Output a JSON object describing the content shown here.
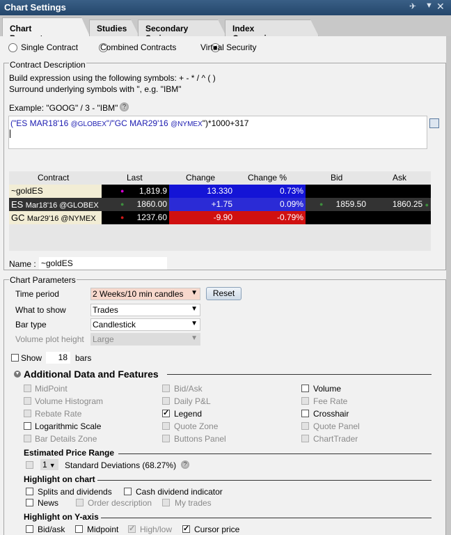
{
  "window": {
    "title": "Chart Settings"
  },
  "tabs": [
    "Chart Parameters",
    "Studies",
    "Secondary Series",
    "Index Comparisons"
  ],
  "contract_type": {
    "options": [
      "Single Contract",
      "Combined Contracts",
      "Virtual Security"
    ],
    "selected": "Virtual Security"
  },
  "contract_description": {
    "section": "Contract Description",
    "line1": "Build expression using the following symbols: + - * / ^ ( )",
    "line2": "Surround underlying symbols with \", e.g. \"IBM\"",
    "example": "Example: \"GOOG\" / 3 - \"IBM\"",
    "expr": {
      "p1": "(\"ES MAR18'16 ",
      "p2": "@GLOBEX",
      "p3": "\"/\"GC MAR29'16 ",
      "p4": "@NYMEX",
      "p5": "\")*1000+317"
    }
  },
  "table": {
    "headers": [
      "Contract",
      "Last",
      "Change",
      "Change %",
      "Bid",
      "Ask"
    ],
    "rows": [
      {
        "contract": "~goldES",
        "sub": "",
        "last": "1,819.9",
        "change": "13.330",
        "change_pct": "0.73%",
        "bid": "",
        "ask": "",
        "dot": "#d400d4"
      },
      {
        "contract": "ES",
        "sub": "Mar18'16 @GLOBEX",
        "last": "1860.00",
        "change": "+1.75",
        "change_pct": "0.09%",
        "bid": "1859.50",
        "ask": "1860.25",
        "dot": "#3e8e3e"
      },
      {
        "contract": "GC",
        "sub": "Mar29'16 @NYMEX",
        "last": "1237.60",
        "change": "-9.90",
        "change_pct": "-0.79%",
        "bid": "",
        "ask": "",
        "dot": "#d01818"
      }
    ]
  },
  "name": {
    "label": "Name :",
    "value": "~goldES"
  },
  "chart_params": {
    "section": "Chart Parameters",
    "time_period": {
      "label": "Time period",
      "value": "2 Weeks/10 min candles"
    },
    "reset": "Reset",
    "what_to_show": {
      "label": "What to show",
      "value": "Trades"
    },
    "bar_type": {
      "label": "Bar type",
      "value": "Candlestick"
    },
    "volume_height": {
      "label": "Volume plot height",
      "value": "Large"
    },
    "show": {
      "label": "Show",
      "value": "18",
      "suffix": "bars"
    }
  },
  "features": {
    "title": "Additional Data and Features",
    "items": [
      [
        "MidPoint",
        "Bid/Ask",
        "Volume"
      ],
      [
        "Volume Histogram",
        "Daily P&L",
        "Fee Rate"
      ],
      [
        "Rebate Rate",
        "Legend",
        "Crosshair"
      ],
      [
        "Logarithmic Scale",
        "Quote Zone",
        "Quote Panel"
      ],
      [
        "Bar Details Zone",
        "Buttons Panel",
        "ChartTrader"
      ]
    ]
  },
  "price_range": {
    "title": "Estimated Price Range",
    "value": "1",
    "label": "Standard Deviations (68.27%)"
  },
  "highlight_chart": {
    "title": "Highlight on chart",
    "splits": "Splits and dividends",
    "cash": "Cash dividend indicator",
    "news": "News",
    "order_desc": "Order description",
    "my_trades": "My trades"
  },
  "highlight_y": {
    "title": "Highlight on Y-axis",
    "bidask": "Bid/ask",
    "midpoint": "Midpoint",
    "highlow": "High/low",
    "cursor": "Cursor price"
  }
}
